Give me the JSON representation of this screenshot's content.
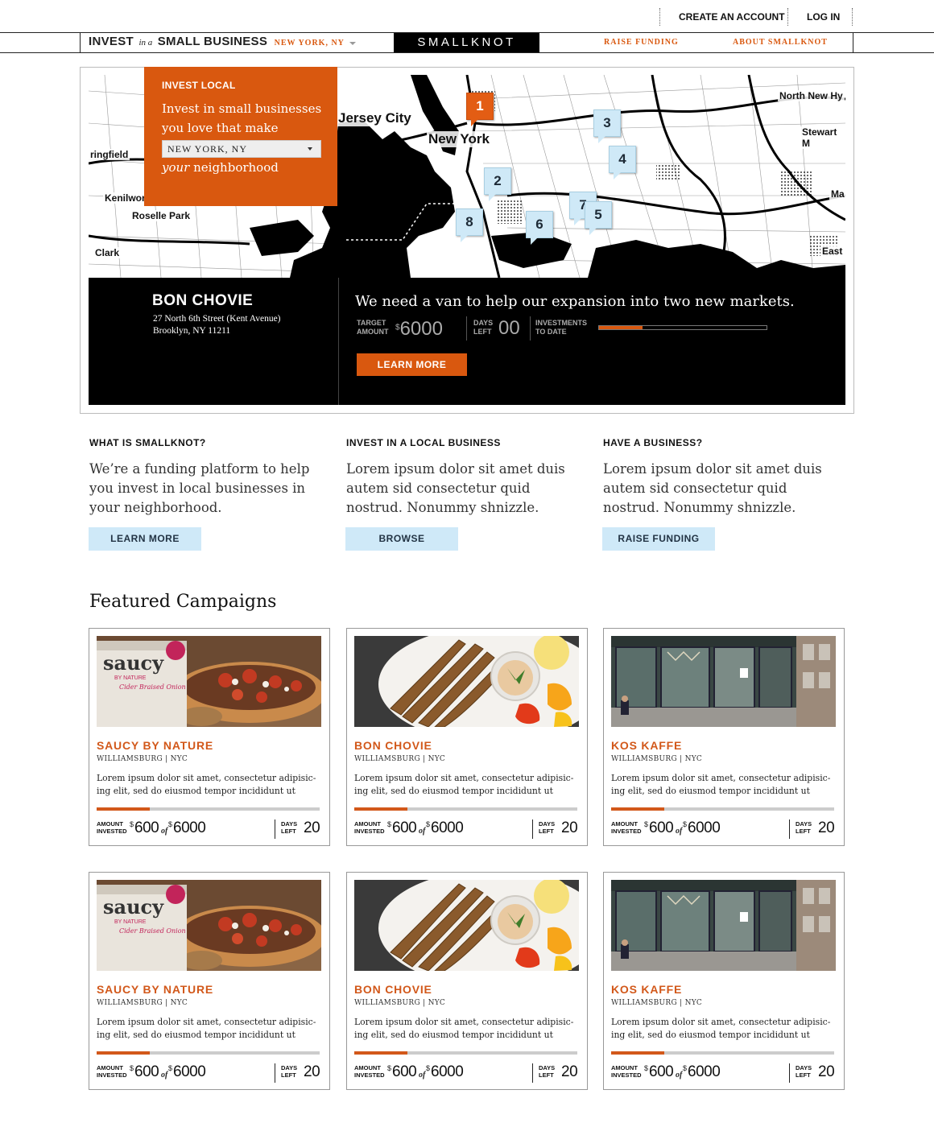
{
  "top_links": {
    "create_account": "CREATE AN ACCOUNT",
    "log_in": "LOG IN"
  },
  "nav": {
    "invest": "INVEST",
    "in_a": "in a",
    "small_business": "SMALL BUSINESS",
    "city": "NEW YORK, NY",
    "brand": "SMALLKNOT",
    "raise_funding": "RAISE FUNDING",
    "about": "ABOUT SMALLKNOT"
  },
  "hero": {
    "box_title": "INVEST LOCAL",
    "line1": "Invest in small businesses",
    "line2": "you love that make",
    "select_value": "NEW YORK, NY",
    "your": "your",
    "neighborhood": "neighborhood",
    "map_labels": [
      "Jersey City",
      "New York",
      "ringfield",
      "Kenilwor",
      "Roselle Park",
      "Clark",
      "North New Hy",
      "Stewart M",
      "Ma",
      "East"
    ],
    "pins": [
      "1",
      "2",
      "3",
      "4",
      "5",
      "6",
      "7",
      "8"
    ],
    "business_name": "BON CHOVIE",
    "address1": "27 North 6th Street (Kent Avenue)",
    "address2": "Brooklyn, NY 11211",
    "headline": "We need a van to help our expansion into two new markets.",
    "target_label_1": "TARGET",
    "target_label_2": "AMOUNT",
    "target_currency": "$",
    "target_value": "6000",
    "days_label_1": "DAYS",
    "days_label_2": "LEFT",
    "days_value": "00",
    "inv_label_1": "INVESTMENTS",
    "inv_label_2": "TO DATE",
    "progress": 0.26,
    "learn_more": "LEARN MORE"
  },
  "columns": [
    {
      "title": "WHAT IS SMALLKNOT?",
      "text": "We’re a funding platform to help you invest in local businesses in your neighborhood.",
      "button": "LEARN MORE"
    },
    {
      "title": "INVEST IN A LOCAL BUSINESS",
      "text": "Lorem ipsum dolor sit amet duis autem sid consectetur quid nostrud. Nonummy shnizzle.",
      "button": "BROWSE"
    },
    {
      "title": "HAVE A BUSINESS?",
      "text": "Lorem ipsum dolor sit amet duis autem sid consectetur quid nostrud. Nonummy shnizzle.",
      "button": "RAISE FUNDING"
    }
  ],
  "featured_title": "Featured Campaigns",
  "campaigns": [
    {
      "name": "SAUCY BY NATURE",
      "location": "WILLIAMSBURG | NYC",
      "desc1": "Lorem ipsum dolor sit amet, consectetur adipisic-",
      "desc2": "ing elit, sed do eiusmod tempor incididunt ut",
      "amount_label_1": "AMOUNT",
      "amount_label_2": "INVESTED",
      "invested": "600",
      "of": "of",
      "goal": "6000",
      "currency": "$",
      "days_label_1": "DAYS",
      "days_label_2": "LEFT",
      "days": "20",
      "progress": 0.24,
      "image": "jar-pizza",
      "jar_text": "saucy",
      "jar_sub": "BY NATURE",
      "jar_flavor": "Cider Braised Onion"
    },
    {
      "name": "BON CHOVIE",
      "location": "WILLIAMSBURG | NYC",
      "desc1": "Lorem ipsum dolor sit amet, consectetur adipisic-",
      "desc2": "ing elit, sed do eiusmod tempor incididunt ut",
      "amount_label_1": "AMOUNT",
      "amount_label_2": "INVESTED",
      "invested": "600",
      "of": "of",
      "goal": "6000",
      "currency": "$",
      "days_label_1": "DAYS",
      "days_label_2": "LEFT",
      "days": "20",
      "progress": 0.24,
      "image": "fried-fish"
    },
    {
      "name": "KOS KAFFE",
      "location": "WILLIAMSBURG | NYC",
      "desc1": "Lorem ipsum dolor sit amet, consectetur adipisic-",
      "desc2": "ing elit, sed do eiusmod tempor incididunt ut",
      "amount_label_1": "AMOUNT",
      "amount_label_2": "INVESTED",
      "invested": "600",
      "of": "of",
      "goal": "6000",
      "currency": "$",
      "days_label_1": "DAYS",
      "days_label_2": "LEFT",
      "days": "20",
      "progress": 0.24,
      "image": "storefront"
    },
    {
      "name": "SAUCY BY NATURE",
      "location": "WILLIAMSBURG | NYC",
      "desc1": "Lorem ipsum dolor sit amet, consectetur adipisic-",
      "desc2": "ing elit, sed do eiusmod tempor incididunt ut",
      "amount_label_1": "AMOUNT",
      "amount_label_2": "INVESTED",
      "invested": "600",
      "of": "of",
      "goal": "6000",
      "currency": "$",
      "days_label_1": "DAYS",
      "days_label_2": "LEFT",
      "days": "20",
      "progress": 0.24,
      "image": "jar-pizza",
      "jar_text": "saucy",
      "jar_sub": "BY NATURE",
      "jar_flavor": "Cider Braised Onion"
    },
    {
      "name": "BON CHOVIE",
      "location": "WILLIAMSBURG | NYC",
      "desc1": "Lorem ipsum dolor sit amet, consectetur adipisic-",
      "desc2": "ing elit, sed do eiusmod tempor incididunt ut",
      "amount_label_1": "AMOUNT",
      "amount_label_2": "INVESTED",
      "invested": "600",
      "of": "of",
      "goal": "6000",
      "currency": "$",
      "days_label_1": "DAYS",
      "days_label_2": "LEFT",
      "days": "20",
      "progress": 0.24,
      "image": "fried-fish"
    },
    {
      "name": "KOS KAFFE",
      "location": "WILLIAMSBURG | NYC",
      "desc1": "Lorem ipsum dolor sit amet, consectetur adipisic-",
      "desc2": "ing elit, sed do eiusmod tempor incididunt ut",
      "amount_label_1": "AMOUNT",
      "amount_label_2": "INVESTED",
      "invested": "600",
      "of": "of",
      "goal": "6000",
      "currency": "$",
      "days_label_1": "DAYS",
      "days_label_2": "LEFT",
      "days": "20",
      "progress": 0.24,
      "image": "storefront"
    }
  ],
  "colors": {
    "accent": "#d9580f",
    "light_blue": "#cfe9f8",
    "black": "#000000"
  }
}
